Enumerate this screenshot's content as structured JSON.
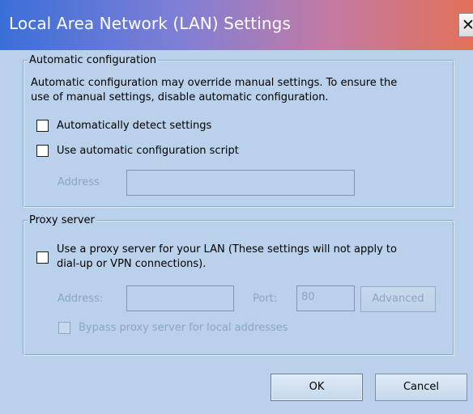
{
  "window": {
    "title": "Local Area Network (LAN) Settings",
    "close_glyph": "✕"
  },
  "automatic_configuration": {
    "legend": "Automatic configuration",
    "description_line1": "Automatic configuration may override manual settings.  To ensure the",
    "description_line2": "use of manual settings, disable automatic configuration.",
    "detect_settings_label": "Automatically detect settings",
    "detect_settings_checked": false,
    "use_script_label": "Use automatic configuration script",
    "use_script_checked": false,
    "address_label": "Address",
    "address_value": ""
  },
  "proxy_server": {
    "legend": "Proxy server",
    "use_proxy_label_line1": "Use a proxy server for your LAN (These settings will not apply to",
    "use_proxy_label_line2": "dial-up or VPN connections).",
    "use_proxy_checked": false,
    "address_label": "Address:",
    "address_value": "",
    "port_label": "Port:",
    "port_value": "80",
    "advanced_label": "Advanced",
    "bypass_label": "Bypass proxy server for local addresses",
    "bypass_checked": false
  },
  "buttons": {
    "ok_label": "OK",
    "cancel_label": "Cancel"
  },
  "colors": {
    "dialog_background": "#b9d1ea",
    "disabled_text": "#8da5c3"
  }
}
